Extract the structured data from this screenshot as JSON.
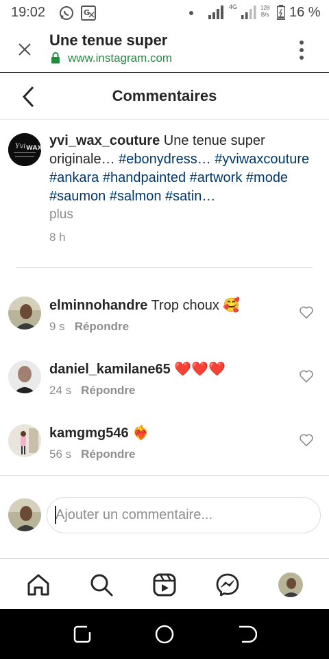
{
  "status_bar": {
    "time": "19:02",
    "network": "4G",
    "speed_top": "128",
    "speed_bottom": "B/s",
    "battery": "16 %"
  },
  "browser": {
    "title": "Une tenue super",
    "url": "www.instagram.com"
  },
  "header": {
    "title": "Commentaires"
  },
  "caption": {
    "username": "yvi_wax_couture",
    "text": " Une tenue super originale… ",
    "hashtags": [
      "#ebonydress…",
      "#yviwaxcouture",
      "#ankara",
      "#handpainted",
      "#artwork",
      "#mode",
      "#saumon",
      "#salmon",
      "#satin…"
    ],
    "more": "plus",
    "time": "8 h"
  },
  "comments": [
    {
      "username": "elminnohandre",
      "text": " Trop choux ",
      "emoji": "🥰",
      "time": "9 s",
      "reply": "Répondre"
    },
    {
      "username": "daniel_kamilane65",
      "text": " ",
      "emoji": "❤️❤️❤️",
      "time": "24 s",
      "reply": "Répondre"
    },
    {
      "username": "kamgmg546",
      "text": " ",
      "emoji": "❤️‍🔥",
      "time": "56 s",
      "reply": "Répondre"
    }
  ],
  "compose": {
    "placeholder": "Ajouter un commentaire..."
  },
  "icons": {
    "heart": "heart-outline-icon",
    "home": "home-icon",
    "search": "search-icon",
    "reels": "reels-icon",
    "messenger": "messenger-icon"
  },
  "colors": {
    "hashtag": "#00376b",
    "secure_url": "#1e8e3e",
    "muted": "#8e8e8e"
  }
}
